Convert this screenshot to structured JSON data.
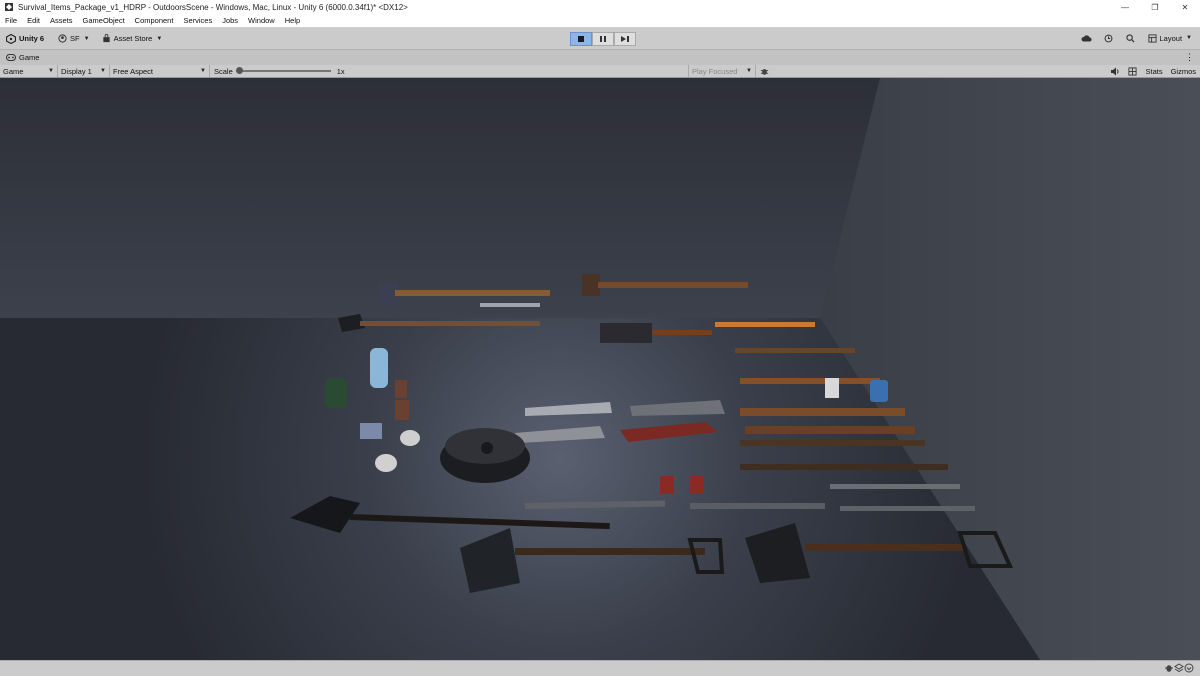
{
  "window": {
    "title": "Survival_Items_Package_v1_HDRP - OutdoorsScene - Windows, Mac, Linux - Unity 6 (6000.0.34f1)* <DX12>",
    "controls": [
      "—",
      "❐",
      "✕"
    ]
  },
  "menu": [
    "File",
    "Edit",
    "Assets",
    "GameObject",
    "Component",
    "Services",
    "Jobs",
    "Window",
    "Help"
  ],
  "toolbar": {
    "unity_label": "Unity 6",
    "account_label": "SF",
    "asset_store_label": "Asset Store",
    "layout_label": "Layout"
  },
  "tab": {
    "label": "Game"
  },
  "game_toolbar": {
    "mode": "Game",
    "display": "Display 1",
    "aspect": "Free Aspect",
    "scale_label": "Scale",
    "scale_value": "1x",
    "scale_level": 0,
    "play_focused": "Play Focused",
    "stats": "Stats",
    "gizmos": "Gizmos"
  },
  "icons": {
    "title": "unity-icon",
    "cloud": "cloud-icon",
    "history": "history-icon",
    "search": "search-icon",
    "audio": "audio-icon",
    "grid": "grid-icon",
    "bug": "bug-icon"
  }
}
